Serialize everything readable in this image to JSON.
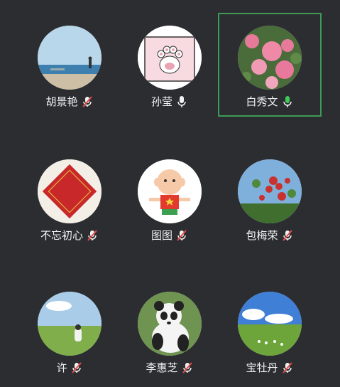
{
  "participants": [
    {
      "name": "胡景艳",
      "mic": "muted",
      "avatar": "sea-beach"
    },
    {
      "name": "孙莹",
      "mic": "on-white",
      "avatar": "cat-paw"
    },
    {
      "name": "白秀文",
      "mic": "on-green",
      "avatar": "pink-roses",
      "active": true
    },
    {
      "name": "不忘初心",
      "mic": "muted",
      "avatar": "fu-character"
    },
    {
      "name": "图图",
      "mic": "muted",
      "avatar": "cartoon-boy"
    },
    {
      "name": "包梅荣",
      "mic": "muted",
      "avatar": "red-berries"
    },
    {
      "name": "许",
      "mic": "muted",
      "avatar": "grassland-person"
    },
    {
      "name": "李惠芝",
      "mic": "muted",
      "avatar": "panda"
    },
    {
      "name": "宝牡丹",
      "mic": "muted",
      "avatar": "grassland-sheep"
    }
  ],
  "colors": {
    "background": "#2b2d31",
    "active_border": "#3f9a57",
    "mic_green": "#3fc957",
    "muted_red": "#e14b4b"
  }
}
